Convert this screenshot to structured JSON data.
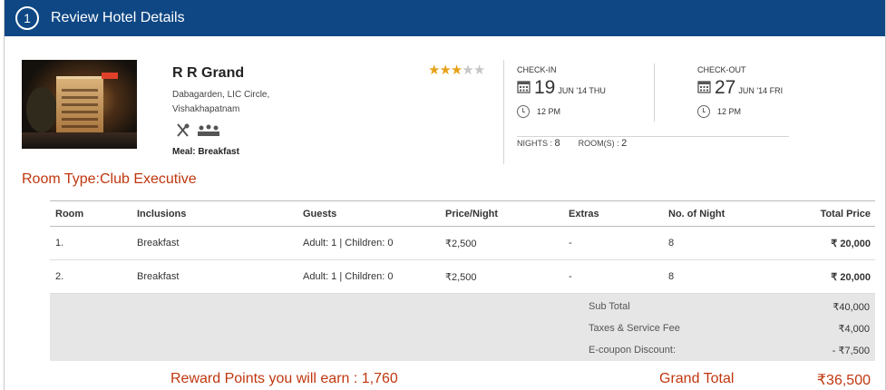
{
  "header": {
    "step_number": "1",
    "title": "Review Hotel Details"
  },
  "hotel": {
    "name": "R R Grand",
    "address_line1": "Dabagarden, LIC Circle,",
    "address_line2": "Vishakhapatnam",
    "meal": "Meal: Breakfast",
    "rating": 3,
    "rating_max": 5,
    "amenity_icons": [
      "restaurant-icon",
      "conference-icon"
    ]
  },
  "checkin": {
    "label": "CHECK-IN",
    "day": "19",
    "rest": "JUN '14 THU",
    "time": "12 PM"
  },
  "checkout": {
    "label": "CHECK-OUT",
    "day": "27",
    "rest": "JUN '14 FRI",
    "time": "12 PM"
  },
  "stay": {
    "nights_label": "NIGHTS :",
    "nights": "8",
    "rooms_label": "ROOM(S) :",
    "rooms": "2"
  },
  "room_type": "Room Type:Club Executive",
  "table": {
    "headers": [
      "Room",
      "Inclusions",
      "Guests",
      "Price/Night",
      "Extras",
      "No. of Night",
      "Total Price"
    ],
    "rows": [
      [
        "1.",
        "Breakfast",
        "Adult: 1 | Children: 0",
        "₹2,500",
        "-",
        "8",
        "₹ 20,000"
      ],
      [
        "2.",
        "Breakfast",
        "Adult: 1 | Children: 0",
        "₹2,500",
        "-",
        "8",
        "₹ 20,000"
      ]
    ]
  },
  "summary": {
    "subtotal_label": "Sub Total",
    "subtotal": "₹40,000",
    "taxes_label": "Taxes & Service Fee",
    "taxes": "₹4,000",
    "coupon_label": "E-coupon Discount:",
    "coupon": "- ₹7,500"
  },
  "footer": {
    "reward": "Reward Points you will earn : 1,760",
    "grand_total_label": "Grand Total",
    "grand_total": "₹36,500"
  },
  "colors": {
    "header_bg": "#0f4784",
    "accent": "#c0370f",
    "star": "#e7a21b"
  }
}
